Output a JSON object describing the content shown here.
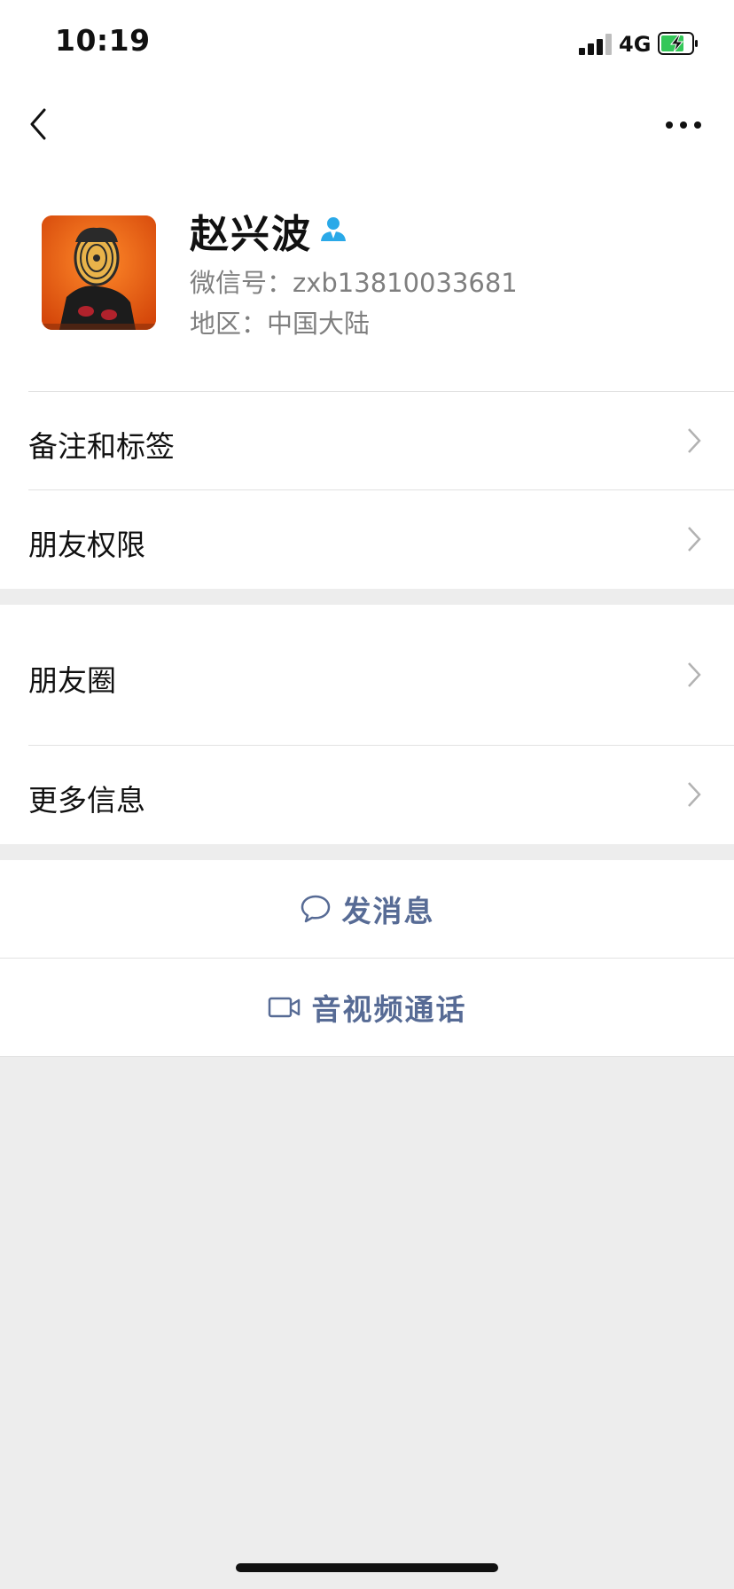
{
  "status_bar": {
    "time": "10:19",
    "network": "4G"
  },
  "nav": {
    "back_icon": "chevron-left-icon",
    "more_icon": "more-dots-icon"
  },
  "profile": {
    "name": "赵兴波",
    "wechat_id": "微信号：zxb13810033681",
    "region": "地区：中国大陆"
  },
  "menu_group1": [
    {
      "label": "备注和标签"
    },
    {
      "label": "朋友权限"
    }
  ],
  "menu_group2": [
    {
      "label": "朋友圈"
    },
    {
      "label": "更多信息"
    }
  ],
  "actions": {
    "message": "发消息",
    "video_call": "音视频通话"
  },
  "colors": {
    "accent": "#576b95",
    "background": "#ededed",
    "person_icon": "#2aa9e8",
    "battery": "#34c759"
  }
}
